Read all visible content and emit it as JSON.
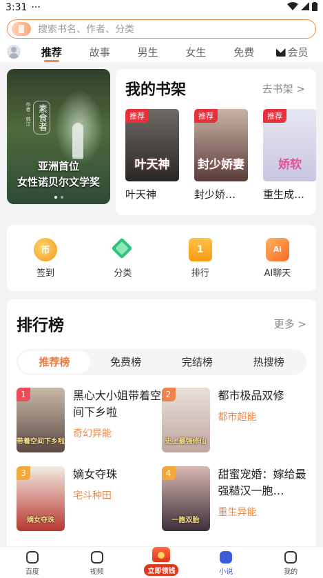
{
  "status": {
    "time": "3:31",
    "dots": "···"
  },
  "search": {
    "placeholder": "搜索书名、作者、分类"
  },
  "tabs": [
    "推荐",
    "故事",
    "男生",
    "女生",
    "免费",
    "会员"
  ],
  "banner": {
    "book_title": "素食者",
    "author_meta": "作者 · 韩江",
    "caption_line1": "亚洲首位",
    "caption_line2": "女性诺贝尔文学奖"
  },
  "shelf": {
    "title": "我的书架",
    "link": "去书架 >",
    "books": [
      {
        "badge": "推荐",
        "name": "叶天神",
        "cover_text": "叶天神"
      },
      {
        "badge": "推荐",
        "name": "封少娇…",
        "cover_text": "封少娇妻"
      },
      {
        "badge": "推荐",
        "name": "重生成…",
        "cover_text": "娇软"
      }
    ]
  },
  "quick": [
    {
      "label": "签到",
      "icon": "coin-icon"
    },
    {
      "label": "分类",
      "icon": "category-icon"
    },
    {
      "label": "排行",
      "icon": "ranking-icon"
    },
    {
      "label": "AI聊天",
      "icon": "ai-chat-icon"
    }
  ],
  "ranking": {
    "title": "排行榜",
    "link": "更多 >",
    "tabs": [
      "推荐榜",
      "免费榜",
      "完结榜",
      "热搜榜"
    ],
    "items": [
      {
        "num": "1",
        "title": "黑心大小姐带着空间下乡啦",
        "category": "奇幻异能",
        "cover_text": "带着空间下乡啦"
      },
      {
        "num": "2",
        "title": "都市极品双修",
        "category": "都市超能",
        "cover_text": "史上最强修仙"
      },
      {
        "num": "3",
        "title": "嫡女夺珠",
        "category": "宅斗种田",
        "cover_text": "嫡女夺珠"
      },
      {
        "num": "4",
        "title": "甜蜜宠婚：嫁给最强糙汉一胞…",
        "category": "重生异能",
        "cover_text": "一胞双胎"
      }
    ]
  },
  "bottom_nav": [
    {
      "label": "百度",
      "icon": "baidu-icon"
    },
    {
      "label": "视频",
      "icon": "video-icon"
    },
    {
      "label": "立即领钱",
      "icon": "red-packet-icon"
    },
    {
      "label": "小说",
      "icon": "novel-icon"
    },
    {
      "label": "我的",
      "icon": "profile-icon"
    }
  ]
}
